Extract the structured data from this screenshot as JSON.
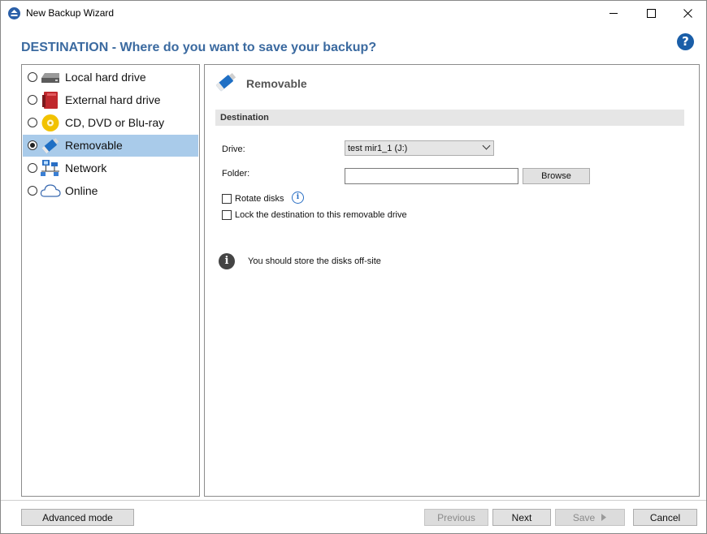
{
  "window": {
    "title": "New Backup Wizard"
  },
  "header": {
    "title": "DESTINATION - Where do you want to save your backup?",
    "help_label": "?"
  },
  "destinations": [
    {
      "label": "Local hard drive",
      "icon": "hard-drive-icon",
      "selected": false
    },
    {
      "label": "External hard drive",
      "icon": "external-drive-icon",
      "selected": false
    },
    {
      "label": "CD, DVD or Blu-ray",
      "icon": "disc-icon",
      "selected": false
    },
    {
      "label": "Removable",
      "icon": "usb-drive-icon",
      "selected": true
    },
    {
      "label": "Network",
      "icon": "network-icon",
      "selected": false
    },
    {
      "label": "Online",
      "icon": "cloud-icon",
      "selected": false
    }
  ],
  "panel": {
    "title": "Removable",
    "section": "Destination",
    "drive_label": "Drive:",
    "drive_value": "test mir1_1 (J:)",
    "folder_label": "Folder:",
    "folder_value": "",
    "browse_label": "Browse",
    "rotate_label": "Rotate disks",
    "rotate_checked": false,
    "lock_label": "Lock the destination to this removable drive",
    "lock_checked": false,
    "info_text": "You should store the disks off-site"
  },
  "footer": {
    "advanced": "Advanced mode",
    "previous": "Previous",
    "next": "Next",
    "save": "Save",
    "cancel": "Cancel"
  },
  "colors": {
    "heading": "#3b6aa0",
    "selection": "#a9cbea",
    "accent": "#1a5ea8"
  }
}
